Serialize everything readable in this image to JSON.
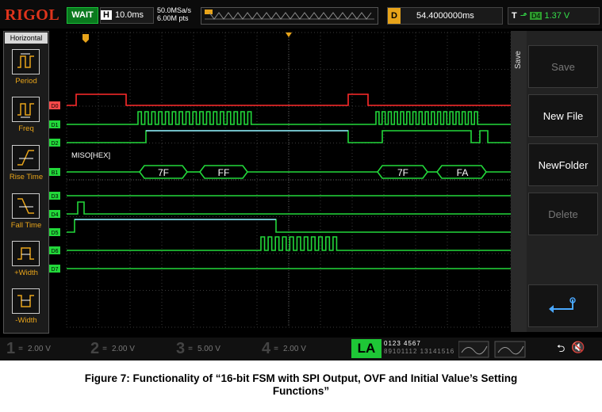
{
  "topbar": {
    "brand": "RIGOL",
    "status": "WAIT",
    "timebase_label": "H",
    "timebase_value": "10.0ms",
    "sample_rate": "50.0MSa/s",
    "memory_depth": "6.00M pts",
    "delay_label": "D",
    "delay_value": "54.4000000ms",
    "trigger_label": "T",
    "trigger_source": "D4",
    "trigger_level": "1.37 V"
  },
  "left_menu": {
    "title": "Horizontal",
    "items": [
      {
        "label": "Period",
        "icon": "period-measure-icon"
      },
      {
        "label": "Freq",
        "icon": "frequency-measure-icon"
      },
      {
        "label": "Rise Time",
        "icon": "rise-time-icon"
      },
      {
        "label": "Fall Time",
        "icon": "fall-time-icon"
      },
      {
        "label": "+Width",
        "icon": "positive-width-icon"
      },
      {
        "label": "-Width",
        "icon": "negative-width-icon"
      }
    ]
  },
  "right_menu": {
    "tab": "Save",
    "buttons": [
      {
        "label": "Save",
        "enabled": false
      },
      {
        "label": "New File",
        "enabled": true
      },
      {
        "label": "NewFolder",
        "enabled": true
      },
      {
        "label": "Delete",
        "enabled": false
      }
    ],
    "enter_icon": "enter-return-icon"
  },
  "waveform": {
    "channels": [
      "D0",
      "D1",
      "D2",
      "B1",
      "D3",
      "D4",
      "D5",
      "D6",
      "D7"
    ],
    "bus_label": "MISO[HEX]",
    "bus_values": [
      "7F",
      "FF",
      "7F",
      "FA"
    ],
    "colors": {
      "red": "#ff2a2a",
      "green": "#22d83a",
      "blue": "#8fd8ff",
      "marker": "#e8a41a"
    }
  },
  "bottombar": {
    "channels": [
      {
        "num": "1",
        "scale": "2.00 V"
      },
      {
        "num": "2",
        "scale": "2.00 V"
      },
      {
        "num": "3",
        "scale": "5.00 V"
      },
      {
        "num": "4",
        "scale": "2.00 V"
      }
    ],
    "la_label": "LA",
    "la_channels_top": "0123 4567",
    "la_channels_bottom": "89101112 13141516",
    "usb_icon": "usb-icon",
    "mute_icon": "speaker-mute-icon"
  },
  "caption": {
    "line1": "Figure 7: Functionality of “16-bit FSM with SPI Output, OVF and Initial Value’s Setting",
    "line2": "Functions”"
  }
}
